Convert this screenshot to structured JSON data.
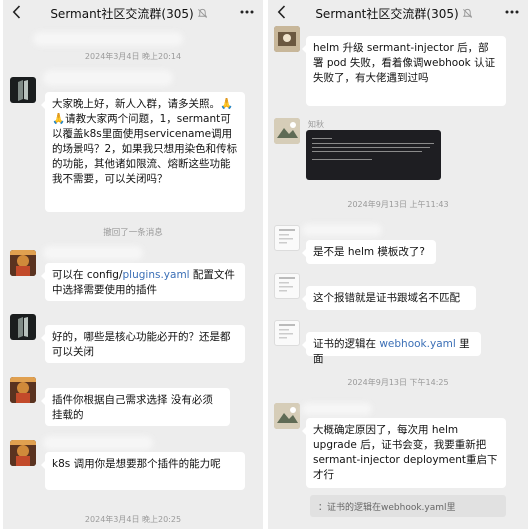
{
  "left": {
    "title": "Sermant社区交流群(305)",
    "timestamps": {
      "t1": "2024年3月4日 晚上20:14",
      "t2": "2024年3月4日 晚上20:25"
    },
    "system_msg": "撤回了一条消息",
    "messages": {
      "m1": "大家晚上好，新人入群，请多关照。🙏🙏请教大家两个问题，1，sermant可以覆盖k8s里面使用servicename调用的场景吗？2，如果我只想用染色和传标的功能，其他诸如限流、熔断这些功能我不需要，可以关闭吗？",
      "m2_prefix": "可以在 config/",
      "m2_link": "plugins.yaml",
      "m2_suffix": " 配置文件中选择需要使用的插件",
      "m3": "好的，哪些是核心功能必开的？还是都可以关闭",
      "m4": "插件你根据自己需求选择 没有必须挂载的",
      "m5": "k8s 调用你是想要那个插件的能力呢"
    }
  },
  "right": {
    "title": "Sermant社区交流群(305)",
    "timestamps": {
      "t1": "2024年9月13日 上午11:43",
      "t2": "2024年9月13日 下午14:25"
    },
    "nick": "知秋",
    "messages": {
      "r1": "helm 升级 sermant-injector 后，部署 pod 失败，看着像调webhook 认证失败了，有大佬遇到过吗",
      "r3": "是不是 helm 模板改了?",
      "r4": "这个报错就是证书跟域名不匹配",
      "r5_prefix": "证书的逻辑在 ",
      "r5_link": "webhook.yaml",
      "r5_suffix": " 里面",
      "r6": "大概确定原因了，每次用 helm upgrade 后，证书会变，我要重新把 sermant-injector deployment重启下才行"
    },
    "quote": "：证书的逻辑在webhook.yaml里"
  },
  "colors": {
    "chat_bg": "#ededed",
    "bubble": "#ffffff",
    "link": "#3b6fb6",
    "meta": "#9a9a9a"
  },
  "icons": [
    "back-icon",
    "mute-icon",
    "more-icon"
  ]
}
